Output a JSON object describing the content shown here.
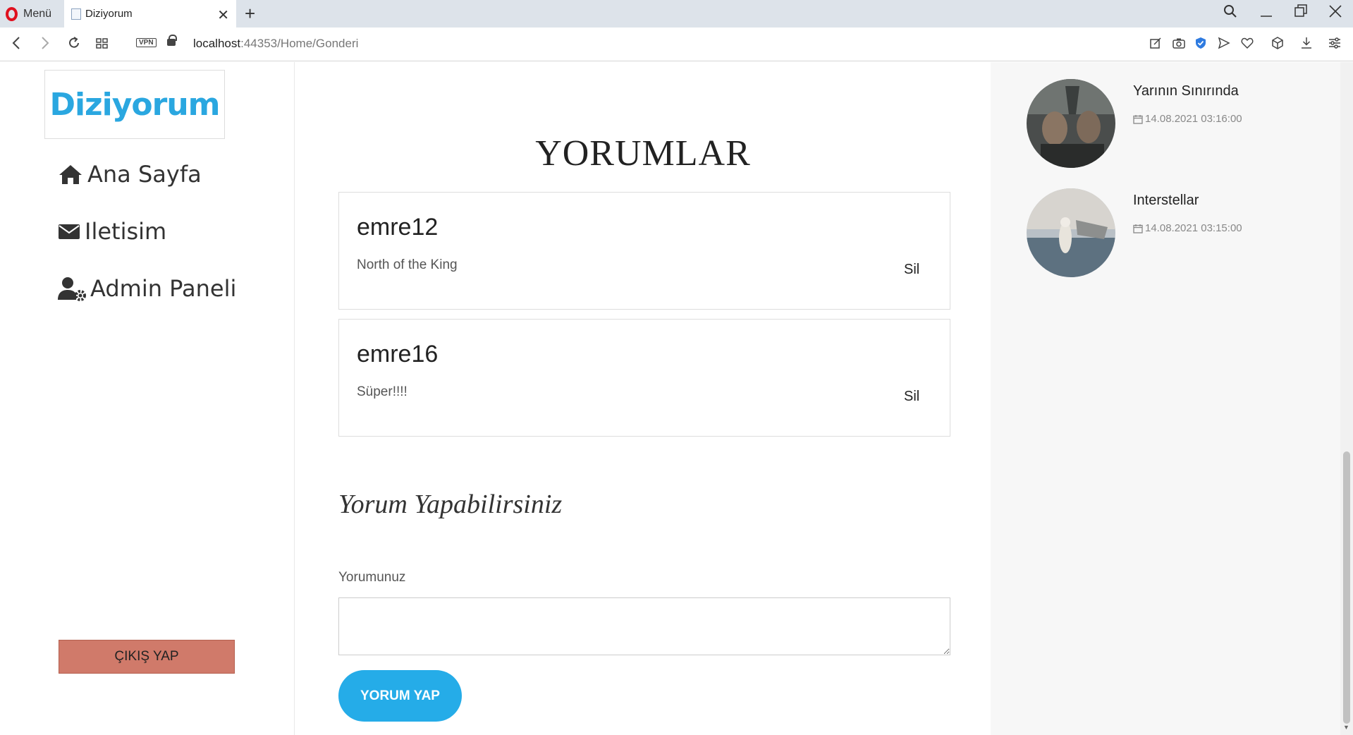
{
  "browser": {
    "menu_label": "Menü",
    "tab_title": "Diziyorum",
    "url_host": "localhost",
    "url_path": ":44353/Home/Gonderi",
    "vpn_label": "VPN"
  },
  "sidebar": {
    "logo": "Diziyorum",
    "nav": [
      {
        "label": "Ana Sayfa",
        "icon": "home-icon"
      },
      {
        "label": "Iletisim",
        "icon": "envelope-icon"
      },
      {
        "label": "Admin Paneli",
        "icon": "user-cog-icon"
      }
    ],
    "logout_label": "ÇIKIŞ YAP"
  },
  "main": {
    "title": "YORUMLAR",
    "comments": [
      {
        "user": "emre12",
        "text": "North of the King",
        "delete_label": "Sil"
      },
      {
        "user": "emre16",
        "text": "Süper!!!!",
        "delete_label": "Sil"
      }
    ],
    "form_title": "Yorum Yapabilirsiniz",
    "form_label": "Yorumunuz",
    "input_value": "",
    "submit_label": "YORUM YAP"
  },
  "right": {
    "posts": [
      {
        "title": "Yarının Sınırında",
        "date": "14.08.2021 03:16:00"
      },
      {
        "title": "Interstellar",
        "date": "14.08.2021 03:15:00"
      }
    ]
  },
  "colors": {
    "accent": "#25ace8",
    "logo": "#2aa7e0",
    "logout": "#d07a6a",
    "opera": "#e0111f"
  }
}
